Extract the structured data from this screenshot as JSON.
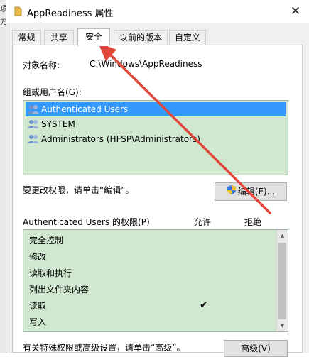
{
  "window": {
    "title": "AppReadiness 属性",
    "close_glyph": "✕",
    "folder_color": "#e8b94a"
  },
  "tabs": [
    {
      "label": "常规"
    },
    {
      "label": "共享"
    },
    {
      "label": "安全",
      "active": true
    },
    {
      "label": "以前的版本"
    },
    {
      "label": "自定义"
    }
  ],
  "security": {
    "object_name_label": "对象名称:",
    "object_name_value": "C:\\Windows\\AppReadiness",
    "group_label": "组或用户名(G):",
    "users": [
      {
        "name": "Authenticated Users",
        "icon": "users-group-icon",
        "selected": true
      },
      {
        "name": "SYSTEM",
        "icon": "users-group-icon",
        "selected": false
      },
      {
        "name": "Administrators (HFSP\\Administrators)",
        "icon": "users-group-icon",
        "selected": false
      }
    ],
    "change_hint": "要更改权限，请单击“编辑”。",
    "edit_button": "编辑(E)...",
    "permissions_label": "Authenticated Users 的权限(P)",
    "allow_header": "允许",
    "deny_header": "拒绝",
    "permissions": [
      {
        "name": "完全控制",
        "allow": false,
        "deny": false
      },
      {
        "name": "修改",
        "allow": false,
        "deny": false
      },
      {
        "name": "读取和执行",
        "allow": false,
        "deny": false
      },
      {
        "name": "列出文件夹内容",
        "allow": false,
        "deny": false
      },
      {
        "name": "读取",
        "allow": true,
        "deny": false
      },
      {
        "name": "写入",
        "allow": false,
        "deny": false
      }
    ],
    "check_glyph": "✔",
    "advanced_hint": "有关特殊权限或高级设置，请单击“高级”。",
    "advanced_button": "高级(V)"
  },
  "background": {
    "edge_chars": [
      "项",
      "方"
    ]
  },
  "colors": {
    "list_bg": "#cfe8cf",
    "selection": "#3399ff",
    "annotation_arrow": "#e0463b"
  }
}
